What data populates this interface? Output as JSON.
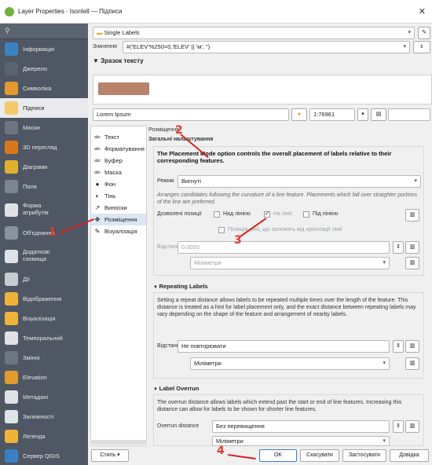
{
  "window": {
    "title": "Layer Properties - Isonlell — Підписи"
  },
  "sidebar": {
    "items": [
      {
        "label": "Інформація",
        "icon": "info-icon",
        "color": "#3b80c3"
      },
      {
        "label": "Джерело",
        "icon": "source-icon",
        "color": "#5a6370"
      },
      {
        "label": "Символіка",
        "icon": "symbology-icon",
        "color": "#e29a2f"
      },
      {
        "label": "Підписи",
        "icon": "labels-icon",
        "color": "#f3c96b"
      },
      {
        "label": "Маски",
        "icon": "mask-icon",
        "color": "#6d7580"
      },
      {
        "label": "3D перегляд",
        "icon": "3d-view-icon",
        "color": "#d9771d"
      },
      {
        "label": "Діаграми",
        "icon": "diagram-icon",
        "color": "#e0b12f"
      },
      {
        "label": "Поля",
        "icon": "fields-icon",
        "color": "#7c8591"
      },
      {
        "label": "Форма\nатрибутів",
        "icon": "form-icon",
        "color": "#dfe3e8"
      },
      {
        "label": "Об'єднання",
        "icon": "join-icon",
        "color": "#8a929d"
      },
      {
        "label": "Додаткові\nсховища",
        "icon": "storage-icon",
        "color": "#dfe3e8"
      },
      {
        "label": "Дії",
        "icon": "actions-icon",
        "color": "#c7ccd2"
      },
      {
        "label": "Відображення",
        "icon": "display-icon",
        "color": "#f0b33a"
      },
      {
        "label": "Візуалізація",
        "icon": "rendering-icon",
        "color": "#f0b33a"
      },
      {
        "label": "Темпоральний",
        "icon": "temporal-icon",
        "color": "#dfe3e8"
      },
      {
        "label": "Змінні",
        "icon": "variables-icon",
        "color": "#6d7580"
      },
      {
        "label": "Elevation",
        "icon": "elevation-icon",
        "color": "#e29a2f"
      },
      {
        "label": "Метадані",
        "icon": "metadata-icon",
        "color": "#dfe3e8"
      },
      {
        "label": "Залежності",
        "icon": "dependencies-icon",
        "color": "#dfe3e8"
      },
      {
        "label": "Легенда",
        "icon": "legend-icon",
        "color": "#f0b33a"
      },
      {
        "label": "Сервер QGIS",
        "icon": "server-icon",
        "color": "#3b80c3"
      }
    ]
  },
  "top": {
    "mode_value": "Single Labels",
    "value_label": "Значення",
    "value_expression": "#('ELEV'%250=0,'ELEV' || 'м', '')",
    "sample_section": "Зразок тексту",
    "sample_text": "Lorem Ipsum",
    "scale": "1:76961"
  },
  "tree": {
    "items": [
      {
        "label": "Текст",
        "icon": "text-icon"
      },
      {
        "label": "Форматування",
        "icon": "formatting-icon"
      },
      {
        "label": "Буфер",
        "icon": "buffer-icon"
      },
      {
        "label": "Маска",
        "icon": "mask-icon"
      },
      {
        "label": "Фон",
        "icon": "background-icon"
      },
      {
        "label": "Тінь",
        "icon": "shadow-icon"
      },
      {
        "label": "Виноски",
        "icon": "callouts-icon"
      },
      {
        "label": "Розміщення",
        "icon": "placement-icon",
        "active": true
      },
      {
        "label": "Візуалізація",
        "icon": "rendering-icon"
      }
    ]
  },
  "placement": {
    "header": "Розміщення",
    "general_title": "Загальні налаштування",
    "general_desc": "The Placement Mode option controls the overall placement of labels relative to their corresponding features.",
    "mode_label": "Режим",
    "mode_value": "Вигнуті",
    "mode_desc": "Arranges candidates following the curvature of a line feature. Placements which fall over straighter portions of the line are preferred.",
    "allowed_label": "Дозволені позиції",
    "above": "Над лінією",
    "on": "На лінії",
    "below": "Під лінією",
    "orientation": "Позиція лінії, що залежить від орієнтації лінії",
    "distance_label": "Відстань",
    "distance_value": "0,0000",
    "units": "Міліметри",
    "repeat_title": "Repeating Labels",
    "repeat_desc": "Setting a repeat distance allows labels to be repeated multiple times over the length of the feature. This distance is treated as a hint for label placement only, and the exact distance between repeating labels may vary depending on the shape of the feature and arrangement of nearby labels.",
    "repeat_distance_label": "Відстань",
    "repeat_value": "Не повторювати",
    "repeat_units": "Міліметри",
    "overrun_title": "Label Overrun",
    "overrun_desc": "The overrun distance allows labels which extend past the start or end of line features. Increasing this distance can allow for labels to be shown for shorter line features.",
    "overrun_label": "Overrun distance",
    "overrun_value": "Без перевищення",
    "overrun_units": "Міліметри"
  },
  "buttons": {
    "style": "Стиль",
    "ok": "OK",
    "cancel": "Скасувати",
    "apply": "Застосувати",
    "help": "Довідка"
  },
  "annotations": [
    "1",
    "2",
    "3",
    "4"
  ],
  "colors": {
    "sidebar_bg": "#4e5763",
    "accent_red": "#d62424",
    "active_tree": "#dbe6f4"
  }
}
